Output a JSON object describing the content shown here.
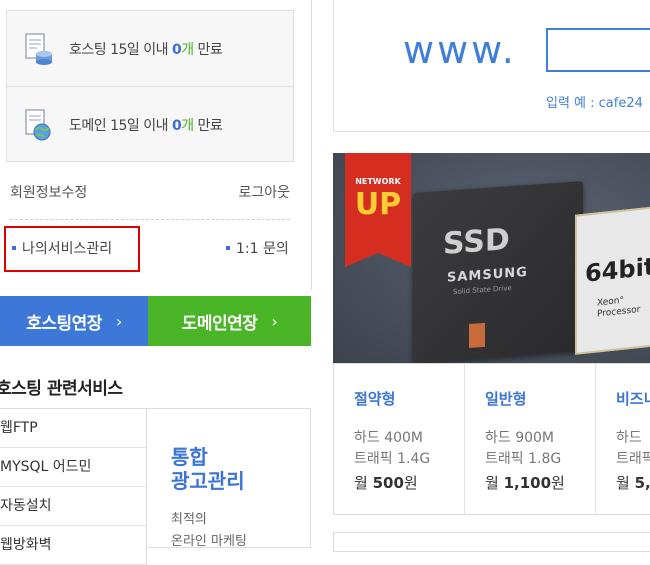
{
  "notices": [
    {
      "icon": "server-icon",
      "prefix": "호스팅 15일 이내 ",
      "count": "0",
      "count_color": "#3a6fd8",
      "suffix": "개 만료",
      "suffix_color": "#4ab526"
    },
    {
      "icon": "globe-icon",
      "prefix": "도메인 15일 이내 ",
      "count": "0",
      "count_color": "#3a6fd8",
      "suffix": "개 만료",
      "suffix_color": "#4ab526"
    }
  ],
  "member": {
    "edit_label": "회원정보수정",
    "logout_label": "로그아웃"
  },
  "services": {
    "my_service": "나의서비스관리",
    "inquiry": "1:1 문의"
  },
  "extend": {
    "hosting": "호스팅연장",
    "domain": "도메인연장",
    "arrow": "›"
  },
  "related": {
    "title": "호스팅 관련서비스",
    "items": [
      "웹FTP",
      "MYSQL 어드민",
      "자동설치",
      "웹방화벽"
    ],
    "ad_title_line1": "통합",
    "ad_title_line2": "광고관리",
    "ad_desc_line1": "최적의",
    "ad_desc_line2": "온라인 마케팅"
  },
  "domain_search": {
    "prefix": "www.",
    "hint": "입력 예 : cafe24"
  },
  "banner": {
    "badge_top": "NETWORK",
    "badge_main": "UP",
    "ssd_label": "SSD",
    "ssd_brand": "SAMSUNG",
    "ssd_sub": "Solid State Drive",
    "cpu_label": "64bit",
    "cpu_sub_line1": "Xeon°",
    "cpu_sub_line2": "Processor"
  },
  "plans": [
    {
      "name": "절약형",
      "spec1": "하드 400M",
      "spec2": "트래픽 1.4G",
      "price_prefix": "월 ",
      "price": "500",
      "price_suffix": "원"
    },
    {
      "name": "일반형",
      "spec1": "하드 900M",
      "spec2": "트래픽 1.8G",
      "price_prefix": "월 ",
      "price": "1,100",
      "price_suffix": "원"
    },
    {
      "name": "비즈니",
      "spec1": "하드",
      "spec2": "트래픽",
      "price_prefix": "월 ",
      "price": "5,",
      "price_suffix": ""
    }
  ],
  "colors": {
    "accent_blue": "#3d78d8",
    "accent_green": "#4ab526",
    "highlight_red": "#e00000"
  }
}
